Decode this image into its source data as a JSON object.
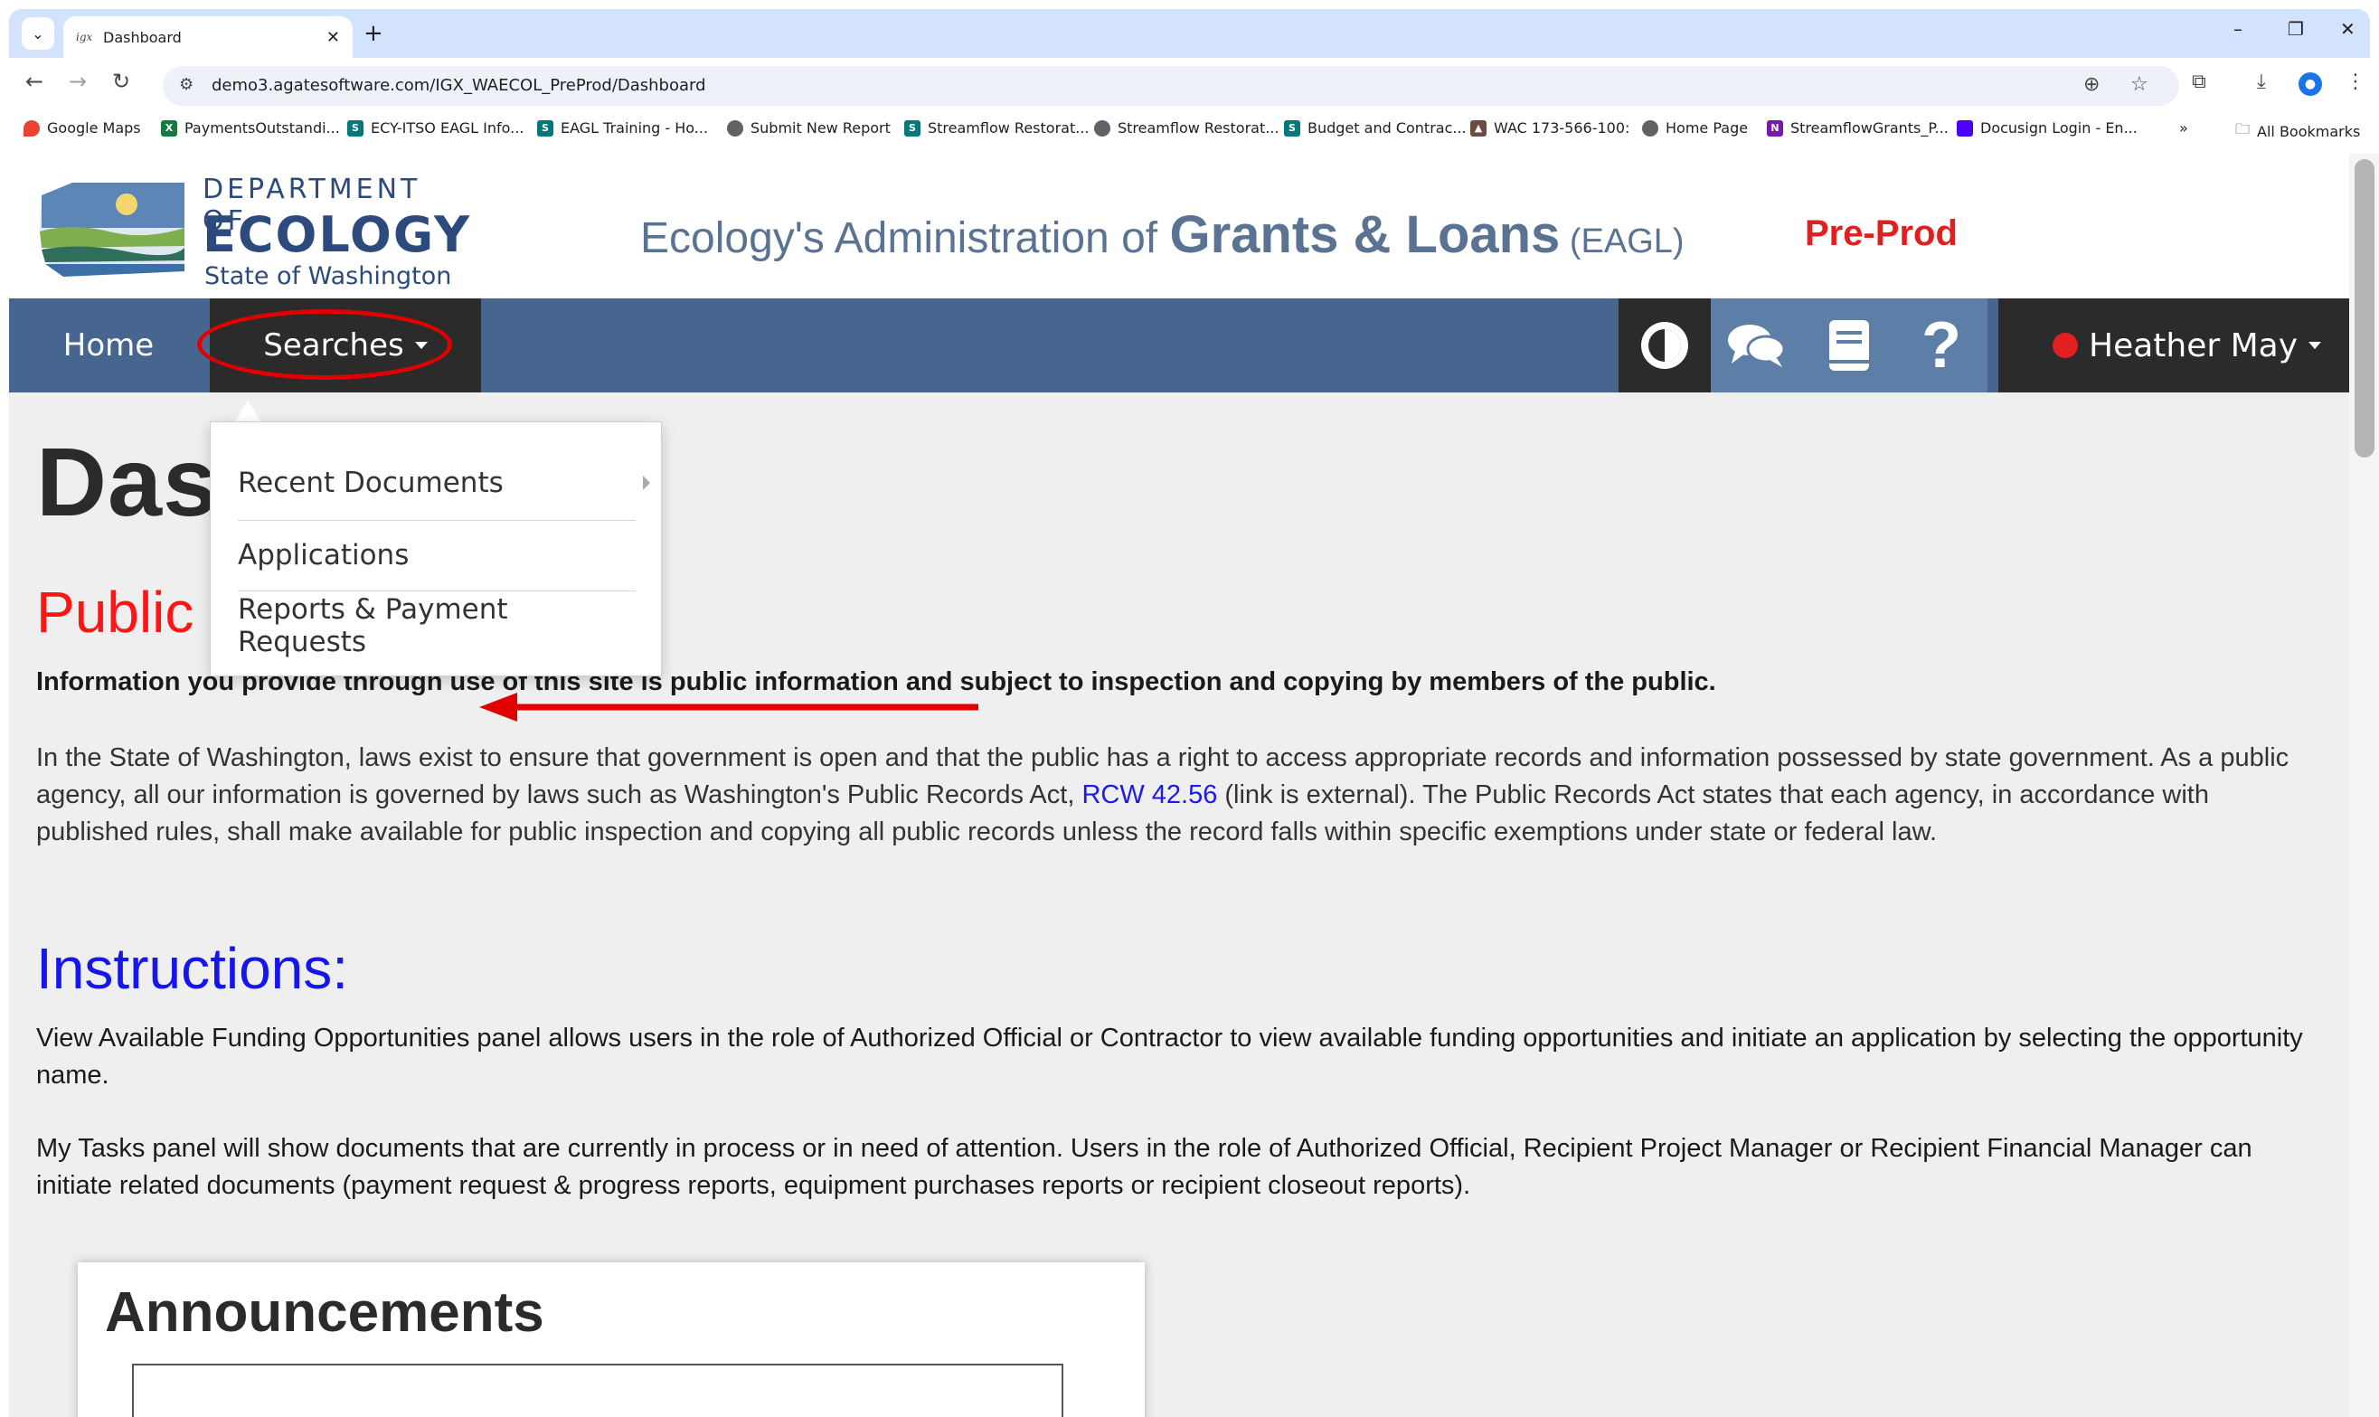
{
  "browser": {
    "tab_title": "Dashboard",
    "tab_favicon": "igx",
    "url": "demo3.agatesoftware.com/IGX_WAECOL_PreProd/Dashboard",
    "bookmarks": [
      {
        "label": "Google Maps",
        "icon": "map-pin-icon",
        "color": "#ea4335"
      },
      {
        "label": "PaymentsOutstandi...",
        "icon": "excel-icon",
        "color": "#107c41"
      },
      {
        "label": "ECY-ITSO EAGL Info...",
        "icon": "sharepoint-icon",
        "color": "#03787c"
      },
      {
        "label": "EAGL Training - Ho...",
        "icon": "sharepoint-icon",
        "color": "#03787c"
      },
      {
        "label": "Submit New Report",
        "icon": "globe-icon",
        "color": "#5f6368"
      },
      {
        "label": "Streamflow Restorat...",
        "icon": "sharepoint-icon",
        "color": "#03787c"
      },
      {
        "label": "Streamflow Restorat...",
        "icon": "globe-icon",
        "color": "#5f6368"
      },
      {
        "label": "Budget and Contrac...",
        "icon": "sharepoint-icon",
        "color": "#03787c"
      },
      {
        "label": "WAC 173-566-100:",
        "icon": "mountain-icon",
        "color": "#6d4c41"
      },
      {
        "label": "Home Page",
        "icon": "globe-icon",
        "color": "#5f6368"
      },
      {
        "label": "StreamflowGrants_P...",
        "icon": "onenote-icon",
        "color": "#7719aa"
      },
      {
        "label": "Docusign Login - En...",
        "icon": "docusign-icon",
        "color": "#4c00ff"
      }
    ],
    "overflow_label": "»",
    "all_bookmarks": "All Bookmarks"
  },
  "header": {
    "logo_line1": "DEPARTMENT OF",
    "logo_line2": "ECOLOGY",
    "logo_line3": "State of Washington",
    "title_part1": "Ecology's Administration of ",
    "title_part2": "Grants & Loans",
    "title_part3": " (EAGL)",
    "environment": "Pre-Prod"
  },
  "nav": {
    "home": "Home",
    "searches": "Searches",
    "user": "Heather May",
    "user_status_color": "#e11f1f",
    "icons": [
      "contrast-icon",
      "chat-icon",
      "book-icon",
      "help-icon"
    ]
  },
  "dropdown": {
    "items": [
      "Recent Documents",
      "Applications",
      "Reports & Payment Requests"
    ]
  },
  "content": {
    "page_title": "Dashboard",
    "public_heading": "Public Records Notice:",
    "public_bold": "Information you provide through use of this site is public information and subject to inspection and copying by members of the public.",
    "public_body_1": "In the State of Washington, laws exist to ensure that government is open and that the public has a right to access appropriate records and information possessed by state government. As a public agency, all our information is governed by laws such as Washington's Public Records Act, ",
    "public_link": "RCW 42.56",
    "public_body_2": " (link is external). The Public Records Act states that each agency, in accordance with published rules, shall make available for public inspection and copying all public records unless the record falls within specific exemptions under state or federal law.",
    "instructions_heading": "Instructions:",
    "instructions_p1": "View Available Funding Opportunities panel allows users in the role of Authorized Official or Contractor to view available funding opportunities and initiate an application by selecting the opportunity name.",
    "instructions_p2": "My Tasks panel will show documents that are currently in process or in need of attention. Users in the role of Authorized Official, Recipient Project Manager or Recipient Financial Manager can initiate related documents (payment request & progress reports, equipment purchases reports or recipient closeout reports).",
    "announcements_title": "Announcements"
  }
}
